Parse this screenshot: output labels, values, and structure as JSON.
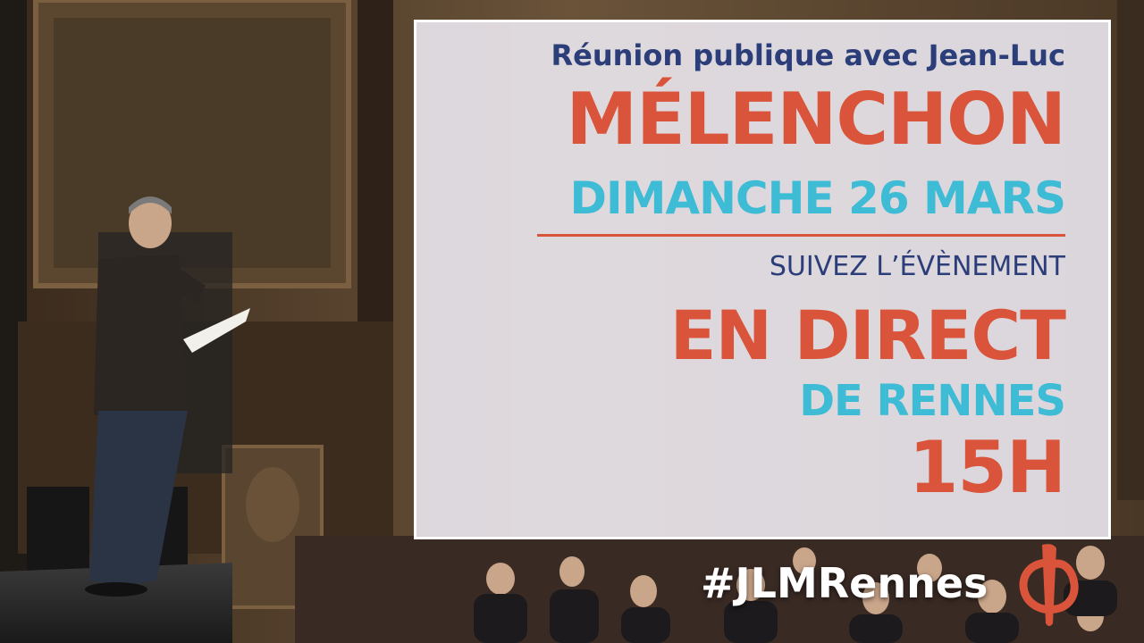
{
  "poster": {
    "line1": "Réunion publique avec Jean-Luc",
    "line2": "MÉLENCHON",
    "line3": "DIMANCHE 26 MARS",
    "line4": "SUIVEZ L’ÉVÈNEMENT",
    "line5": "EN DIRECT",
    "line6": "DE RENNES",
    "line7": "15H"
  },
  "hashtag": "#JLMRennes",
  "icons": {
    "logo": "phi-logo"
  },
  "colors": {
    "navy": "#2c3e7a",
    "red": "#d9543a",
    "cyan": "#3ebbd5"
  }
}
